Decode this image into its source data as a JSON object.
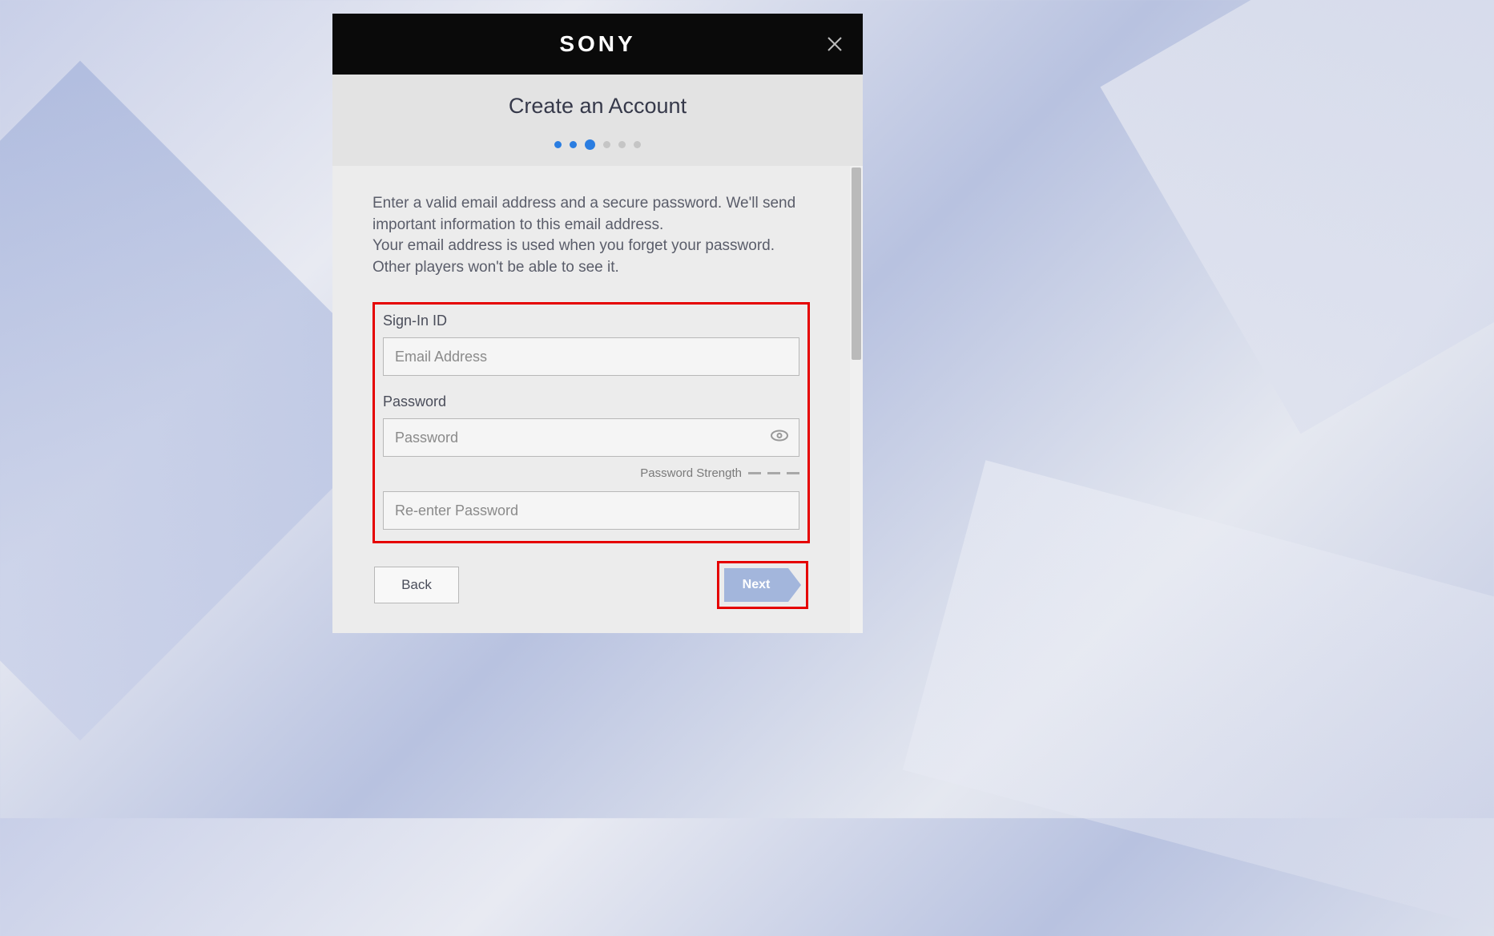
{
  "brand": "SONY",
  "modal": {
    "title": "Create an Account",
    "stepper": {
      "total": 6,
      "current_index": 2,
      "done_indexes": [
        0,
        1
      ]
    },
    "instructions": "Enter a valid email address and a secure password. We'll send important information to this email address.\nYour email address is used when you forget your password. Other players won't be able to see it.",
    "form": {
      "signin_id_label": "Sign-In ID",
      "email_placeholder": "Email Address",
      "email_value": "",
      "password_label": "Password",
      "password_placeholder": "Password",
      "password_value": "",
      "password_strength_label": "Password Strength",
      "reenter_password_placeholder": "Re-enter Password",
      "reenter_password_value": ""
    },
    "buttons": {
      "back": "Back",
      "next": "Next"
    }
  },
  "colors": {
    "accent": "#2a7de1",
    "highlight": "#e50000",
    "next_bg": "#a3b6dc"
  }
}
